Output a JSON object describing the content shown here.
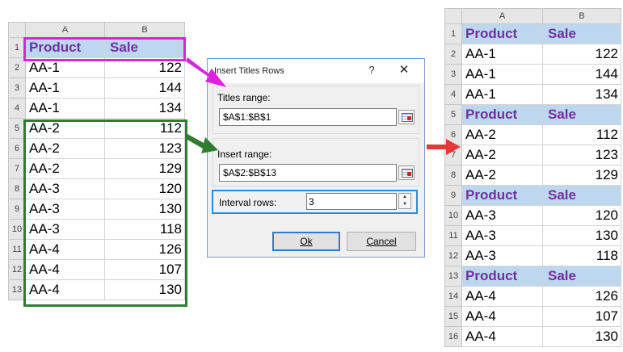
{
  "source_sheet": {
    "columns": [
      "A",
      "B"
    ],
    "header_row": {
      "row": "1",
      "a": "Product",
      "b": "Sale"
    },
    "rows": [
      {
        "row": "2",
        "a": "AA-1",
        "b": "122"
      },
      {
        "row": "3",
        "a": "AA-1",
        "b": "144"
      },
      {
        "row": "4",
        "a": "AA-1",
        "b": "134"
      },
      {
        "row": "5",
        "a": "AA-2",
        "b": "112"
      },
      {
        "row": "6",
        "a": "AA-2",
        "b": "123"
      },
      {
        "row": "7",
        "a": "AA-2",
        "b": "129"
      },
      {
        "row": "8",
        "a": "AA-3",
        "b": "120"
      },
      {
        "row": "9",
        "a": "AA-3",
        "b": "130"
      },
      {
        "row": "10",
        "a": "AA-3",
        "b": "118"
      },
      {
        "row": "11",
        "a": "AA-4",
        "b": "126"
      },
      {
        "row": "12",
        "a": "AA-4",
        "b": "107"
      },
      {
        "row": "13",
        "a": "AA-4",
        "b": "130"
      }
    ]
  },
  "dialog": {
    "title": "Insert Titles Rows",
    "help": "?",
    "close": "✕",
    "titles_range_label": "Titles range:",
    "titles_range_value": "$A$1:$B$1",
    "insert_range_label": "Insert range:",
    "insert_range_value": "$A$2:$B$13",
    "interval_rows_label": "Interval rows:",
    "interval_rows_value": "3",
    "ok_label": "Ok",
    "cancel_label": "Cancel"
  },
  "result_sheet": {
    "columns": [
      "A",
      "B"
    ],
    "rows": [
      {
        "row": "1",
        "a": "Product",
        "b": "Sale",
        "title": true
      },
      {
        "row": "2",
        "a": "AA-1",
        "b": "122"
      },
      {
        "row": "3",
        "a": "AA-1",
        "b": "144"
      },
      {
        "row": "4",
        "a": "AA-1",
        "b": "134"
      },
      {
        "row": "5",
        "a": "Product",
        "b": "Sale",
        "title": true
      },
      {
        "row": "6",
        "a": "AA-2",
        "b": "112"
      },
      {
        "row": "7",
        "a": "AA-2",
        "b": "123"
      },
      {
        "row": "8",
        "a": "AA-2",
        "b": "129"
      },
      {
        "row": "9",
        "a": "Product",
        "b": "Sale",
        "title": true
      },
      {
        "row": "10",
        "a": "AA-3",
        "b": "120"
      },
      {
        "row": "11",
        "a": "AA-3",
        "b": "130"
      },
      {
        "row": "12",
        "a": "AA-3",
        "b": "118"
      },
      {
        "row": "13",
        "a": "Product",
        "b": "Sale",
        "title": true
      },
      {
        "row": "14",
        "a": "AA-4",
        "b": "126"
      },
      {
        "row": "15",
        "a": "AA-4",
        "b": "107"
      },
      {
        "row": "16",
        "a": "AA-4",
        "b": "130"
      }
    ]
  },
  "colors": {
    "title_fill": "#bdd7ee",
    "title_text": "#7030a0",
    "titles_highlight": "#e020e0",
    "insert_highlight": "#2e7d32",
    "interval_highlight": "#2e8bd0",
    "result_arrow": "#e53935"
  }
}
